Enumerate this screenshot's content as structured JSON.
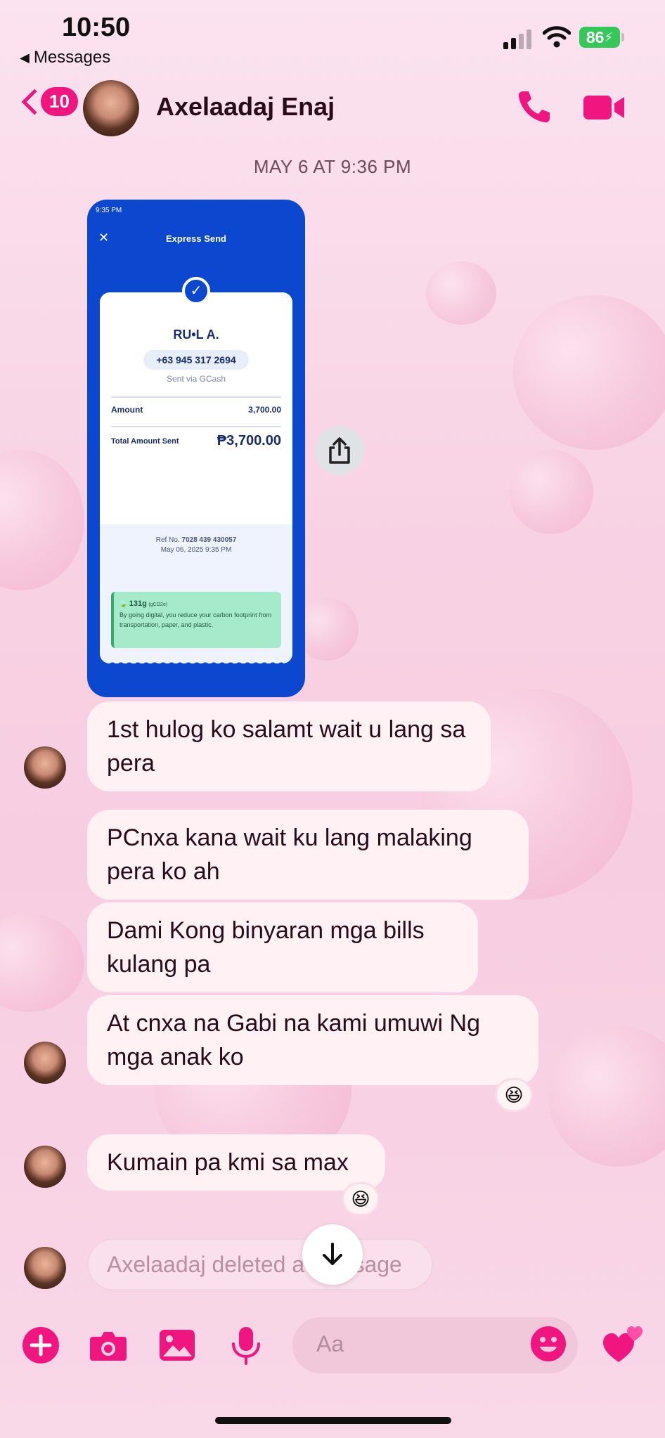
{
  "status_bar": {
    "time": "10:50",
    "back_app": "Messages",
    "battery": "86"
  },
  "header": {
    "unread_count": "10",
    "contact_name": "Axelaadaj Enaj"
  },
  "timestamp": "MAY 6 AT 9:36 PM",
  "receipt": {
    "status_bar_text": "9:35 PM",
    "title": "Express Send",
    "recipient": "RU•L A.",
    "phone": "+63 945 317 2694",
    "sent_via": "Sent via GCash",
    "amount_label": "Amount",
    "amount_value": "3,700.00",
    "total_label": "Total Amount Sent",
    "total_value": "₱3,700.00",
    "ref_label": "Ref No.",
    "ref_value": "7028 439 430057",
    "date": "May 06, 2025 9:35 PM",
    "carbon_value": "131g",
    "carbon_unit": "(gCO2e)",
    "carbon_text": "By going digital, you reduce your carbon footprint from transportation, paper, and plastic."
  },
  "messages": [
    {
      "text": "1st hulog ko salamt wait u lang sa pera"
    },
    {
      "text": "PCnxa kana wait ku lang malaking pera ko ah"
    },
    {
      "text": "Dami Kong binyaran mga bills kulang pa"
    },
    {
      "text": "At cnxa na Gabi na kami umuwi Ng mga anak ko"
    },
    {
      "text": "Kumain pa kmi sa max"
    }
  ],
  "reactions": [
    "😆",
    "😆"
  ],
  "deleted_text": "Axelaadaj deleted a message",
  "composer": {
    "placeholder": "Aa"
  },
  "icons": {
    "add": "plus-circle-icon",
    "camera": "camera-icon",
    "gallery": "image-icon",
    "mic": "microphone-icon",
    "emoji": "smiley-icon",
    "like": "hearts-icon"
  },
  "colors": {
    "accent": "#f0157f",
    "bubble": "#fff1f4",
    "receipt_blue": "#0b47cf"
  }
}
